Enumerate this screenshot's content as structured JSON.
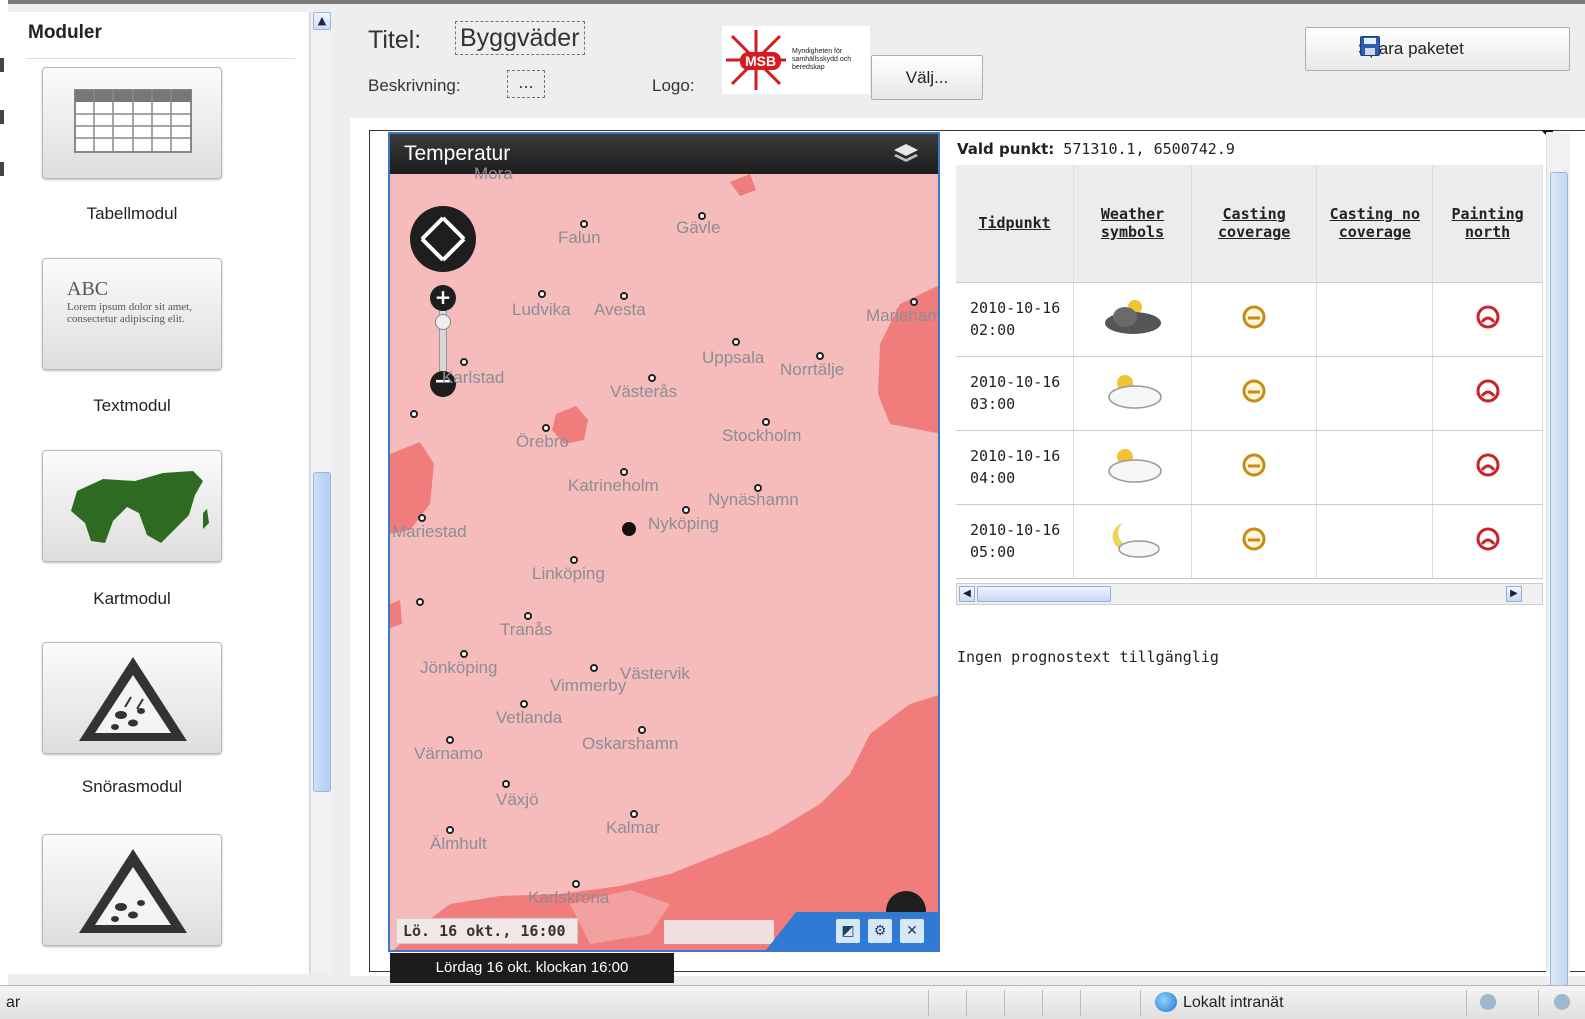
{
  "sidebar": {
    "title": "Moduler",
    "modules": [
      {
        "label": "Tabellmodul",
        "icon": "table-grid-icon"
      },
      {
        "label": "Textmodul",
        "icon": "text-sample-icon",
        "sample_heading": "ABC",
        "sample_body": "Lorem ipsum dolor sit amet, consectetur adipiscing elit."
      },
      {
        "label": "Kartmodul",
        "icon": "map-shape-icon"
      },
      {
        "label": "Snörasmodul",
        "icon": "falling-rocks-warning-icon"
      },
      {
        "label": "",
        "icon": "falling-rocks-warning-icon"
      }
    ]
  },
  "header": {
    "title_label": "Titel:",
    "title_value": "Byggväder",
    "description_label": "Beskrivning:",
    "description_value": "...",
    "logo_label": "Logo:",
    "logo_badge": "MSB",
    "logo_org": "Myndigheten för samhällsskydd och beredskap",
    "choose_label": "Välj...",
    "save_label": "Spara paketet"
  },
  "map": {
    "title": "Temperatur",
    "date_label": "Lö. 16 okt., 16:00",
    "tooltip": "Lördag 16 okt. klockan 16:00",
    "cities": [
      {
        "name": "Mora"
      },
      {
        "name": "Falun"
      },
      {
        "name": "Gävle"
      },
      {
        "name": "Ludvika"
      },
      {
        "name": "Avesta"
      },
      {
        "name": "Mariehamn"
      },
      {
        "name": "Uppsala"
      },
      {
        "name": "Norrtälje"
      },
      {
        "name": "Karlstad"
      },
      {
        "name": "Västerås"
      },
      {
        "name": "Örebro"
      },
      {
        "name": "Stockholm"
      },
      {
        "name": "Katrineholm"
      },
      {
        "name": "Nynäshamn"
      },
      {
        "name": "Mariestad"
      },
      {
        "name": "Nyköping"
      },
      {
        "name": "Linköping"
      },
      {
        "name": "Tranås"
      },
      {
        "name": "Jönköping"
      },
      {
        "name": "Västervik"
      },
      {
        "name": "Vimmerby"
      },
      {
        "name": "Vetlanda"
      },
      {
        "name": "Oskarshamn"
      },
      {
        "name": "Värnamo"
      },
      {
        "name": "Växjö"
      },
      {
        "name": "Kalmar"
      },
      {
        "name": "Älmhult"
      },
      {
        "name": "Karlskrona"
      }
    ],
    "colors": {
      "base": "#f6bcbc",
      "warm": "#f07c7c"
    }
  },
  "forecast": {
    "point_label": "Vald punkt:",
    "point_value": "571310.1, 6500742.9",
    "columns": [
      "Tidpunkt",
      "Weather symbols",
      "Casting coverage",
      "Casting no coverage",
      "Painting north"
    ],
    "rows": [
      {
        "time": "2010-10-16 02:00",
        "weather": "cloud-rain-icon",
        "casting": "neutral-face-icon",
        "painting": "sad-face-icon"
      },
      {
        "time": "2010-10-16 03:00",
        "weather": "cloud-sun-icon",
        "casting": "neutral-face-icon",
        "painting": "sad-face-icon"
      },
      {
        "time": "2010-10-16 04:00",
        "weather": "cloud-sun-icon",
        "casting": "neutral-face-icon",
        "painting": "sad-face-icon"
      },
      {
        "time": "2010-10-16 05:00",
        "weather": "moon-cloud-icon",
        "casting": "neutral-face-icon",
        "painting": "sad-face-icon"
      }
    ],
    "no_forecast": "Ingen prognostext tillgänglig"
  },
  "statusbar": {
    "left_text": "ar",
    "zone": "Lokalt intranät"
  }
}
